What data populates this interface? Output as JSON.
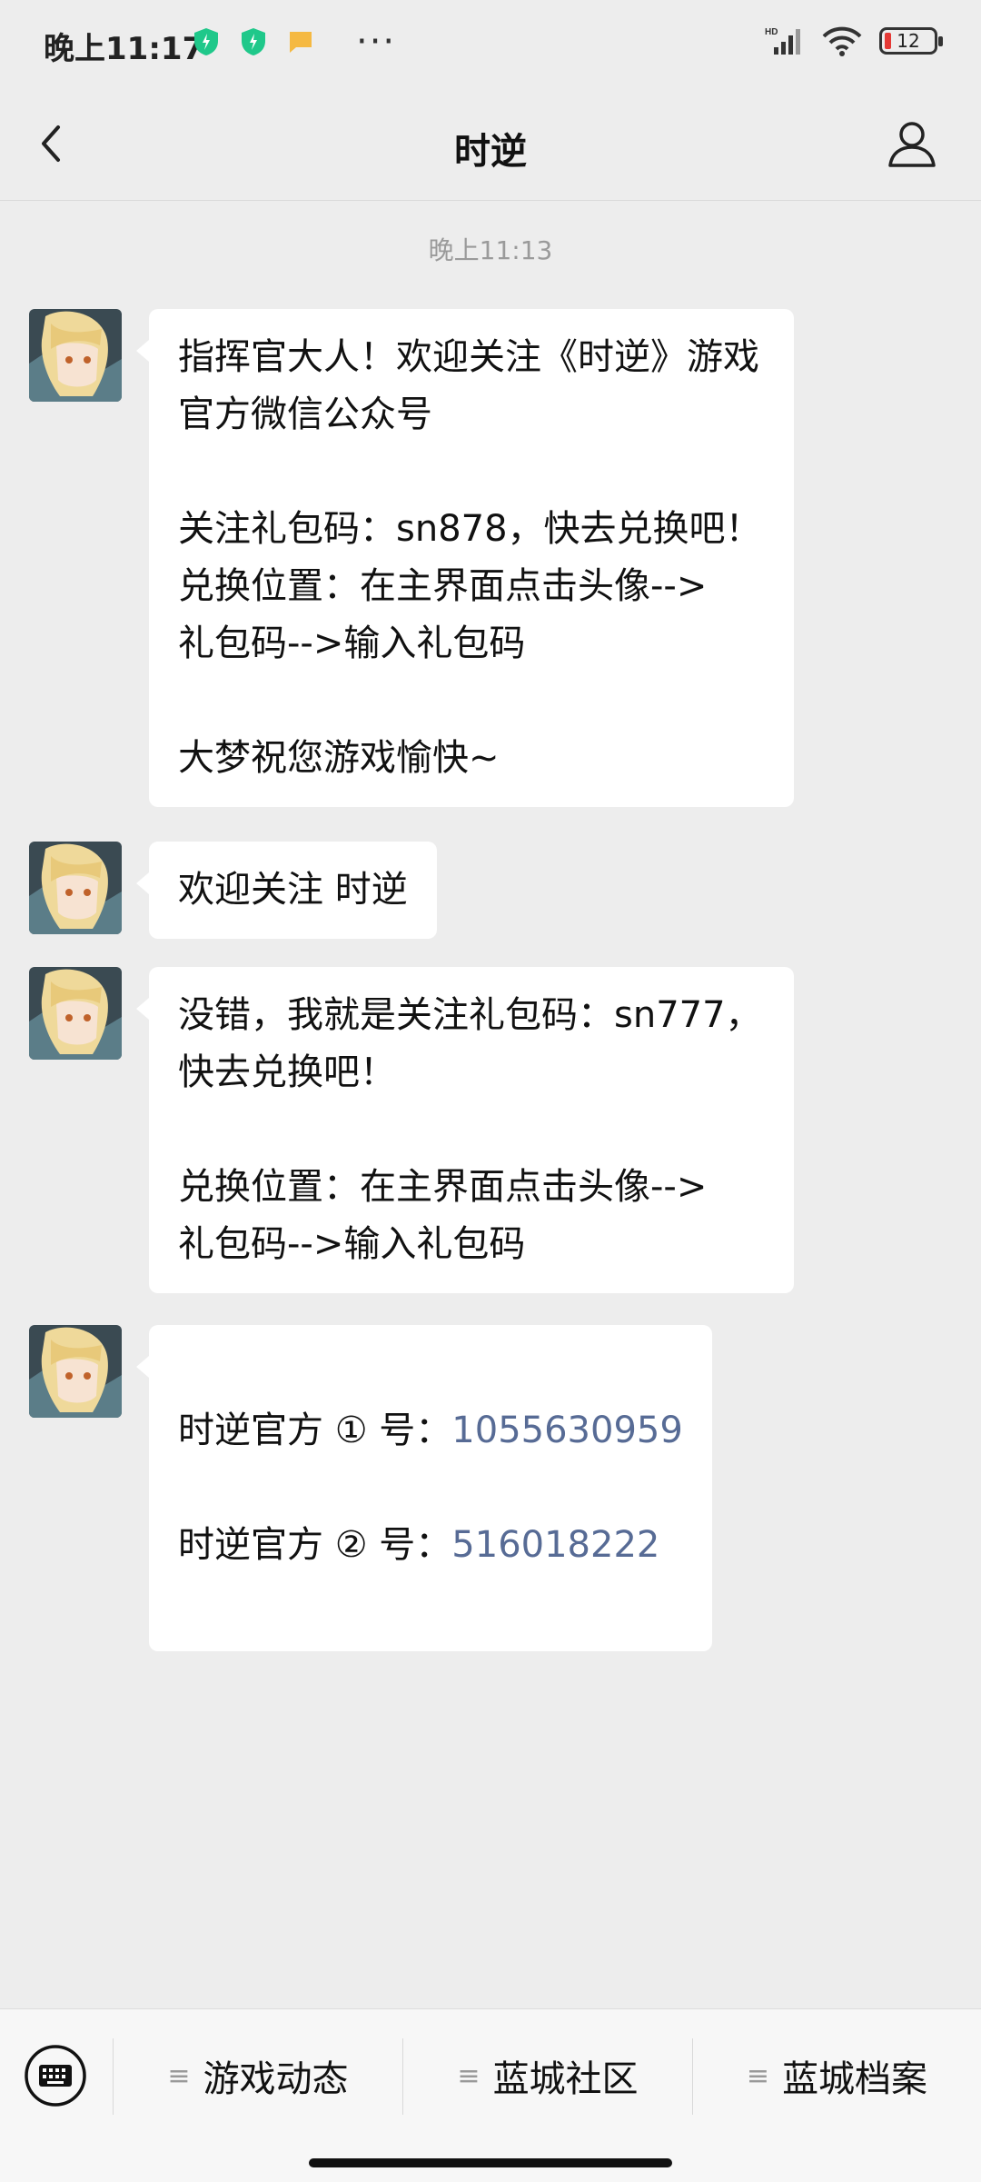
{
  "status_bar": {
    "time": "晚上11:17",
    "more": "···",
    "signal_label": "HD",
    "battery": "12"
  },
  "header": {
    "title": "时逆"
  },
  "chat": {
    "timestamp": "晚上11:13",
    "messages": [
      {
        "text": "指挥官大人！欢迎关注《时逆》游戏\n官方微信公众号\n\n关注礼包码：sn878，快去兑换吧！\n兑换位置：在主界面点击头像-->\n礼包码-->输入礼包码\n\n大梦祝您游戏愉快~"
      },
      {
        "text": "欢迎关注 时逆"
      },
      {
        "text": "没错，我就是关注礼包码：sn777，\n快去兑换吧！\n\n兑换位置：在主界面点击头像-->\n礼包码-->输入礼包码"
      },
      {
        "line1_label": "时逆官方 ① 号：",
        "line1_number": "1055630959",
        "line2_label": "时逆官方 ② 号：",
        "line2_number": "516018222"
      }
    ]
  },
  "menu": {
    "items": [
      {
        "label": "游戏动态"
      },
      {
        "label": "蓝城社区"
      },
      {
        "label": "蓝城档案"
      }
    ]
  },
  "colors": {
    "background": "#ededed",
    "bubble": "#ffffff",
    "link": "#576b95",
    "battery_low": "#e53935",
    "shield": "#1fc88a"
  }
}
